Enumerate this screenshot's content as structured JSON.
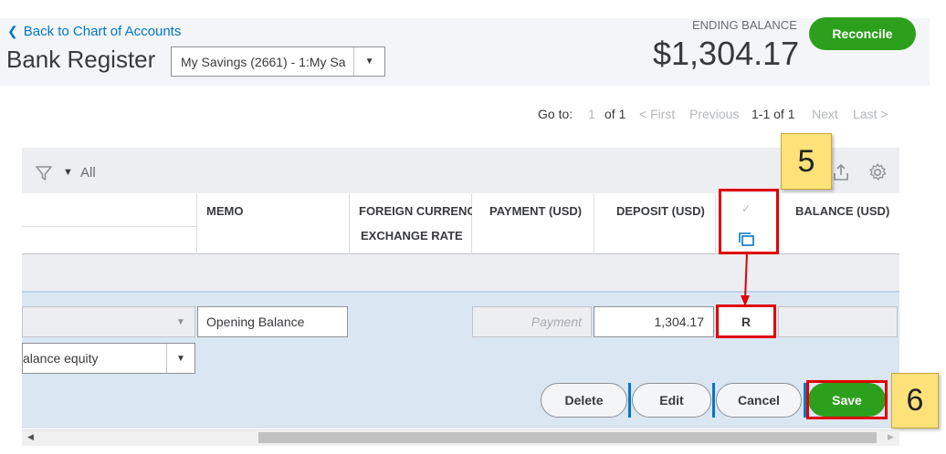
{
  "header": {
    "back_link": "Back to Chart of Accounts",
    "title": "Bank Register",
    "account_select": "My Savings (2661) - 1:My Sa",
    "ending_balance_label": "ENDING BALANCE",
    "ending_balance_value": "$1,304.17",
    "reconcile_label": "Reconcile"
  },
  "pager": {
    "goto_label": "Go to:",
    "page_input": "1",
    "of_pages": "of 1",
    "first": "< First",
    "previous": "Previous",
    "range": "1-1 of 1",
    "next": "Next",
    "last": "Last >"
  },
  "toolbar": {
    "filter_value": "All"
  },
  "columns": {
    "memo": "MEMO",
    "foreign_currency": "FOREIGN CURRENC",
    "exchange_rate": "EXCHANGE RATE",
    "payment": "PAYMENT (USD)",
    "deposit": "DEPOSIT (USD)",
    "balance": "BALANCE (USD)"
  },
  "edit_row": {
    "memo_value": "Opening Balance",
    "payment_placeholder": "Payment",
    "deposit_value": "1,304.17",
    "reconcile_status": "R",
    "account_value": "alance equity"
  },
  "actions": {
    "delete": "Delete",
    "edit": "Edit",
    "cancel": "Cancel",
    "save": "Save"
  },
  "callouts": {
    "step5": "5",
    "step6": "6"
  },
  "icons": {
    "back": "chevron-left-icon",
    "filter": "funnel-icon",
    "export": "export-icon",
    "settings": "gear-icon",
    "check": "checkmark-icon",
    "copy": "copy-icon"
  },
  "colors": {
    "brand_green": "#2ca01c",
    "link_blue": "#0077c5",
    "highlight_red": "#e00000",
    "callout_yellow": "#fde27a"
  }
}
